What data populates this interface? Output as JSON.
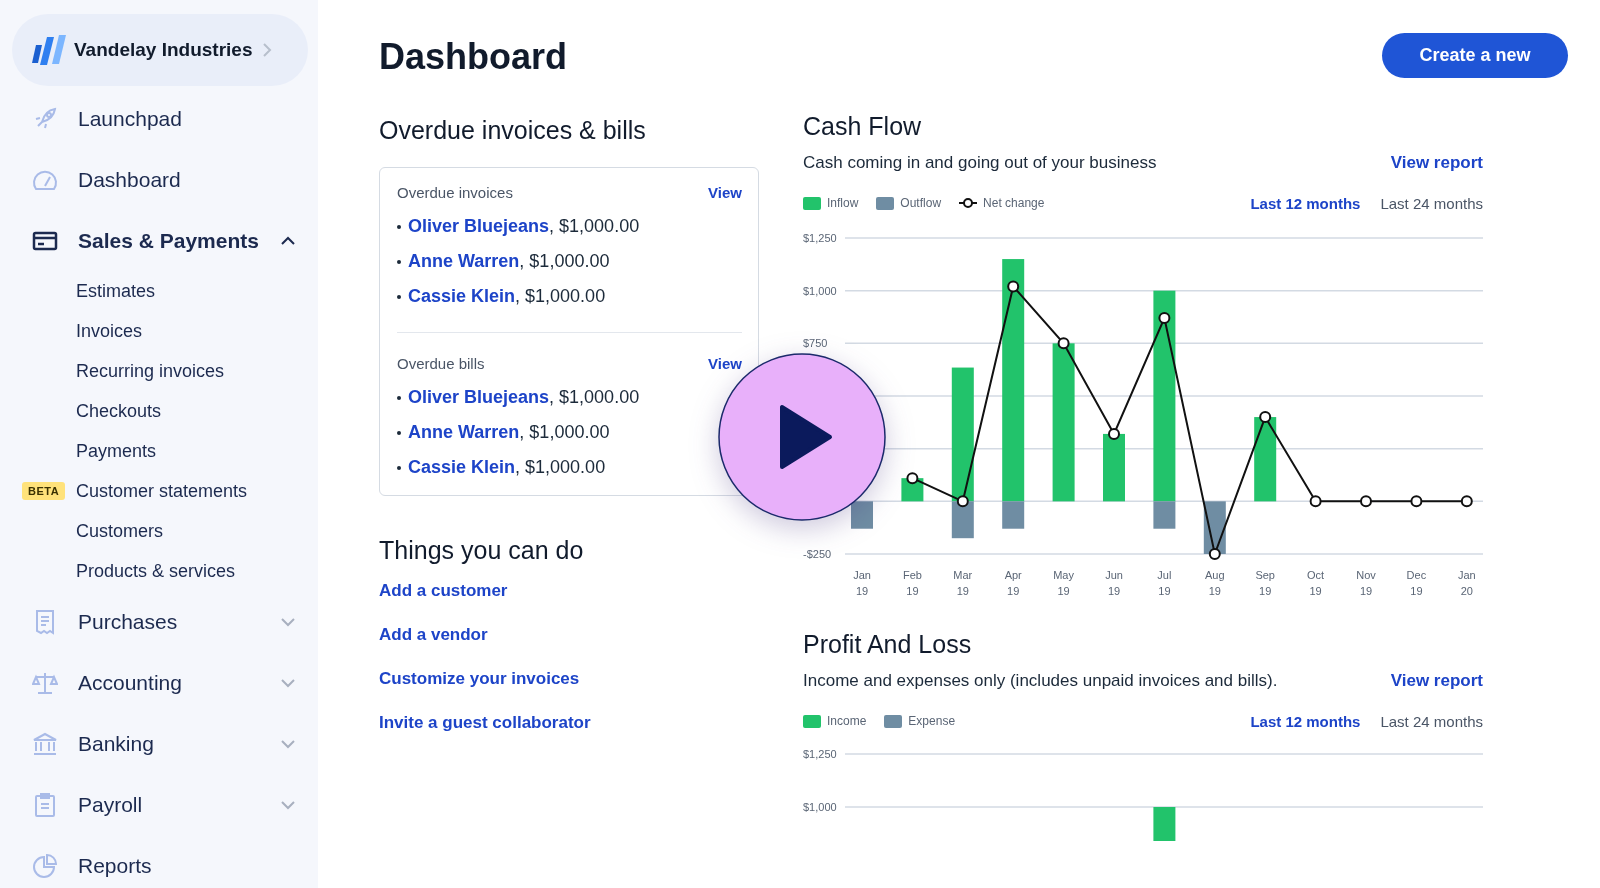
{
  "sidebar": {
    "company": "Vandelay Industries",
    "items": [
      {
        "label": "Launchpad"
      },
      {
        "label": "Dashboard"
      },
      {
        "label": "Sales & Payments",
        "expanded": true,
        "children": [
          {
            "label": "Estimates"
          },
          {
            "label": "Invoices"
          },
          {
            "label": "Recurring invoices"
          },
          {
            "label": "Checkouts"
          },
          {
            "label": "Payments"
          },
          {
            "label": "Customer statements",
            "badge": "BETA"
          },
          {
            "label": "Customers"
          },
          {
            "label": "Products & services"
          }
        ]
      },
      {
        "label": "Purchases",
        "expanded": false
      },
      {
        "label": "Accounting",
        "expanded": false
      },
      {
        "label": "Banking",
        "expanded": false
      },
      {
        "label": "Payroll",
        "expanded": false
      },
      {
        "label": "Reports"
      }
    ]
  },
  "page": {
    "title": "Dashboard",
    "create_button": "Create a new"
  },
  "overdue": {
    "title": "Overdue invoices & bills",
    "sections": [
      {
        "title": "Overdue invoices",
        "link": "View",
        "entries": [
          {
            "name": "Oliver Bluejeans",
            "rest": ", $1,000.00"
          },
          {
            "name": "Anne Warren",
            "rest": ", $1,000.00"
          },
          {
            "name": "Cassie Klein",
            "rest": ", $1,000.00"
          }
        ]
      },
      {
        "title": "Overdue bills",
        "link": "View",
        "entries": [
          {
            "name": "Oliver Bluejeans",
            "rest": ", $1,000.00"
          },
          {
            "name": "Anne Warren",
            "rest": ", $1,000.00"
          },
          {
            "name": "Cassie Klein",
            "rest": ", $1,000.00"
          }
        ]
      }
    ]
  },
  "things": {
    "title": "Things you can do",
    "links": [
      "Add a customer",
      "Add a vendor",
      "Customize your invoices",
      "Invite a guest collaborator"
    ]
  },
  "cash_flow": {
    "title": "Cash Flow",
    "subtitle": "Cash coming in and going out of your business",
    "link": "View report",
    "periods": [
      {
        "label": "Last 12 months",
        "selected": true
      },
      {
        "label": "Last 24 months",
        "selected": false
      }
    ],
    "chart_data": {
      "type": "bar",
      "categories": [
        "Jan 19",
        "Feb 19",
        "Mar 19",
        "Apr 19",
        "May 19",
        "Jun 19",
        "Jul 19",
        "Aug 19",
        "Sep 19",
        "Oct 19",
        "Nov 19",
        "Dec 19",
        "Jan 20"
      ],
      "ylim": [
        -250,
        1250
      ],
      "stacked": true,
      "yticks": [
        {
          "value": 1250,
          "label": "$1,250"
        },
        {
          "value": 1000,
          "label": "$1,000"
        },
        {
          "value": 750,
          "label": "$750"
        },
        {
          "value": -250,
          "label": "-$250"
        }
      ],
      "series": [
        {
          "name": "Inflow",
          "type": "bar",
          "color": "#22c36b",
          "values": [
            null,
            110,
            635,
            1150,
            750,
            320,
            1000,
            0,
            400,
            0,
            0,
            0,
            0
          ]
        },
        {
          "name": "Outflow",
          "type": "bar",
          "color": "#6f8da3",
          "values": [
            -130,
            0,
            -175,
            -130,
            0,
            0,
            -130,
            -250,
            0,
            0,
            0,
            0,
            0
          ]
        },
        {
          "name": "Net change",
          "type": "line",
          "marker": "circle",
          "color": "#111111",
          "values": [
            null,
            110,
            0,
            1020,
            750,
            320,
            870,
            -250,
            400,
            0,
            0,
            0,
            0
          ]
        }
      ]
    }
  },
  "profit_loss": {
    "title": "Profit And Loss",
    "subtitle": "Income and expenses only (includes unpaid invoices and bills).",
    "link": "View report",
    "periods": [
      {
        "label": "Last 12 months",
        "selected": true
      },
      {
        "label": "Last 24 months",
        "selected": false
      }
    ],
    "chart_data": {
      "type": "bar",
      "ylim": [
        1000,
        1250
      ],
      "stacked": true,
      "yticks": [
        {
          "value": 1250,
          "label": "$1,250"
        },
        {
          "value": 1000,
          "label": "$1,000"
        }
      ],
      "series": [
        {
          "name": "Income",
          "type": "bar",
          "color": "#22c36b",
          "values": [
            null,
            null,
            null,
            null,
            null,
            null,
            1000,
            null,
            null,
            null,
            null,
            null,
            null
          ]
        },
        {
          "name": "Expense",
          "type": "bar",
          "color": "#6f8da3",
          "values": [
            null,
            null,
            null,
            null,
            null,
            null,
            null,
            null,
            null,
            null,
            null,
            null,
            null
          ]
        }
      ]
    }
  },
  "overlay": {
    "kind": "play"
  }
}
